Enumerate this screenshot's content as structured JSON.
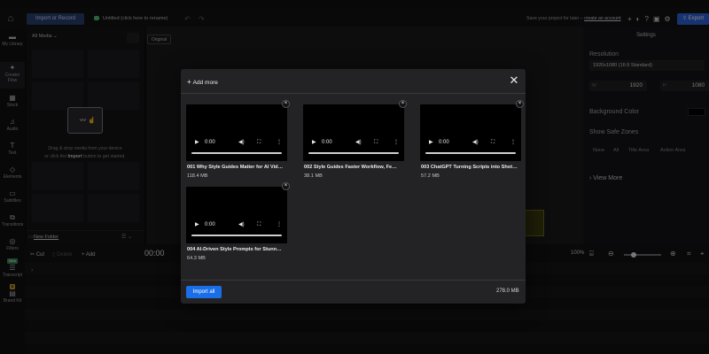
{
  "topbar": {
    "import_label": "Import or Record",
    "project_title": "Untitled (click here to rename)",
    "save_note": "Save your project for later –",
    "create_account": "create an account",
    "export_label": "Export"
  },
  "nav": [
    {
      "label": "My Library",
      "icon": "library-icon"
    },
    {
      "label": "Creator Flow",
      "icon": "creator-flow-icon"
    },
    {
      "label": "Stock",
      "icon": "stock-icon"
    },
    {
      "label": "Audio",
      "icon": "audio-icon"
    },
    {
      "label": "Text",
      "icon": "text-icon"
    },
    {
      "label": "Elements",
      "icon": "elements-icon"
    },
    {
      "label": "Subtitles",
      "icon": "subtitles-icon"
    },
    {
      "label": "Transitions",
      "icon": "transitions-icon"
    },
    {
      "label": "Filters",
      "icon": "filters-icon"
    },
    {
      "label": "Transcript",
      "icon": "transcript-icon",
      "badge": "New"
    },
    {
      "label": "Brand Kit",
      "icon": "brand-kit-icon"
    }
  ],
  "media": {
    "filter": "All Media",
    "drop_line1": "Drag & drop media from your device",
    "drop_line2_a": "or click the",
    "drop_line2_b": "Import",
    "drop_line2_c": "button to get started.",
    "new_folder": "New Folder"
  },
  "canvas": {
    "original_label": "Original"
  },
  "settings": {
    "title": "Settings",
    "resolution_label": "Resolution",
    "resolution_value": "1920x1080 (16:9 Standard)",
    "width_key": "W",
    "width_value": "1920",
    "height_key": "H",
    "height_value": "1080",
    "bg_label": "Background Color",
    "bg_color": "#000000",
    "safe_zones_label": "Show Safe Zones",
    "safe_zones": [
      "None",
      "All",
      "Title Area",
      "Action Area"
    ],
    "view_more": "View More"
  },
  "timeline": {
    "cut": "Cut",
    "delete": "Delete",
    "add": "Add",
    "time": "00:00",
    "zoom": "100%",
    "zoom_level": 0.27
  },
  "modal": {
    "add_more": "Add more",
    "videos": [
      {
        "name": "001 Why Style Guides Matter for AI Vid…",
        "size": "118.4 MB",
        "time": "0:00"
      },
      {
        "name": "002 Style Guides Faster Workflow, Fe…",
        "size": "38.1 MB",
        "time": "0:00"
      },
      {
        "name": "003 ChatGPT Turning Scripts into Shot…",
        "size": "57.2 MB",
        "time": "0:00"
      },
      {
        "name": "004 AI-Driven Style Prompts for Stunn…",
        "size": "64.3 MB",
        "time": "0:00"
      }
    ],
    "import_all": "Import all",
    "total_size": "278.0 MB"
  }
}
